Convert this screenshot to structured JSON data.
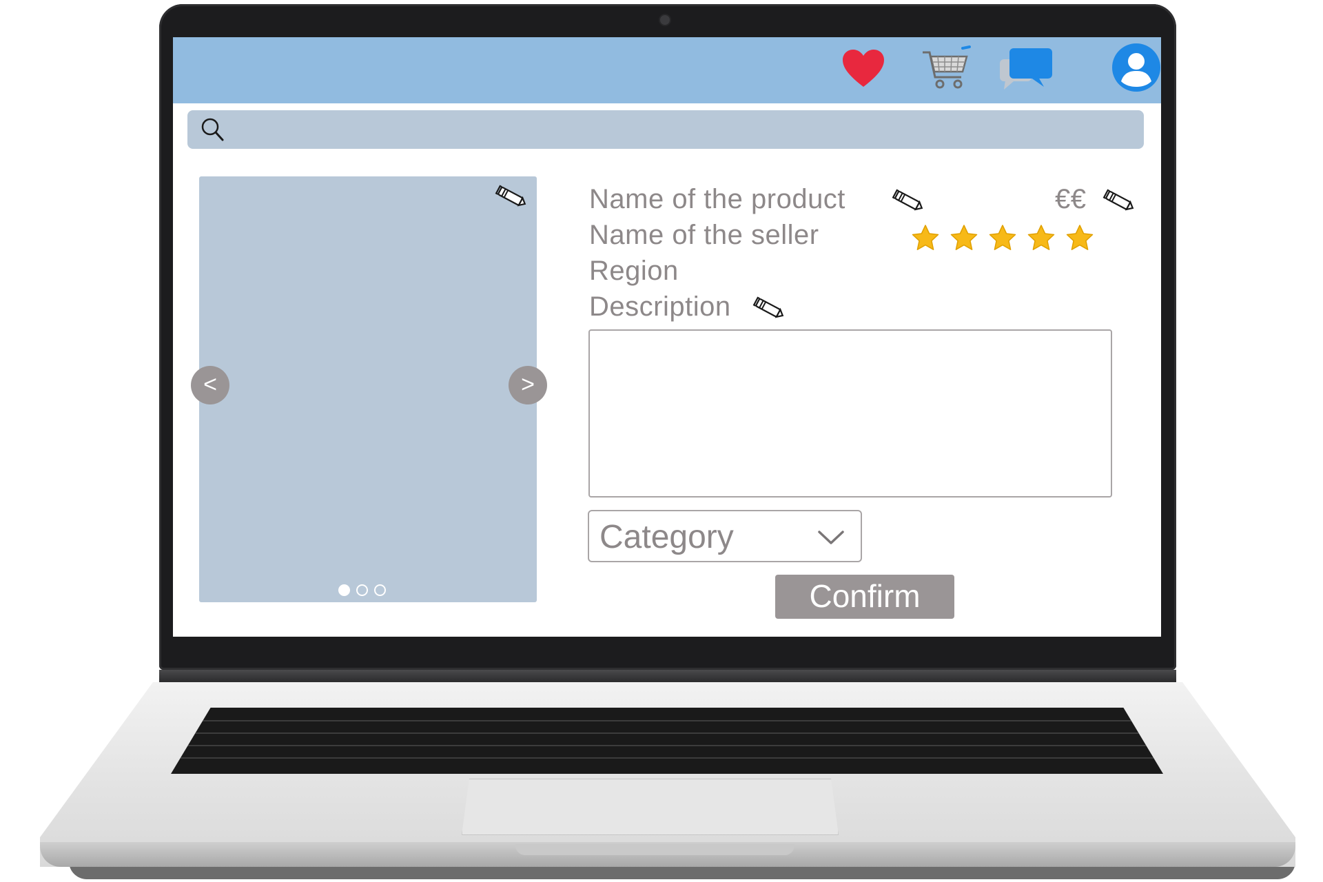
{
  "header": {
    "icons": [
      "heart-icon",
      "shopping-cart-icon",
      "chat-icon",
      "user-profile-icon"
    ],
    "colors": {
      "bar": "#91bbe0",
      "heart": "#e8283e",
      "chat": "#1e88e5",
      "profile": "#1e88e5"
    }
  },
  "search": {
    "placeholder": ""
  },
  "gallery": {
    "prev_label": "<",
    "next_label": ">",
    "slide_count": 3,
    "active_slide": 1
  },
  "product": {
    "name_label": "Name of the product",
    "price_label": "€€",
    "seller_label": "Name of the seller",
    "rating": 5,
    "rating_max": 5,
    "region_label": "Region",
    "description_label": "Description",
    "description_value": ""
  },
  "category": {
    "selected": "Category"
  },
  "actions": {
    "confirm_label": "Confirm"
  }
}
